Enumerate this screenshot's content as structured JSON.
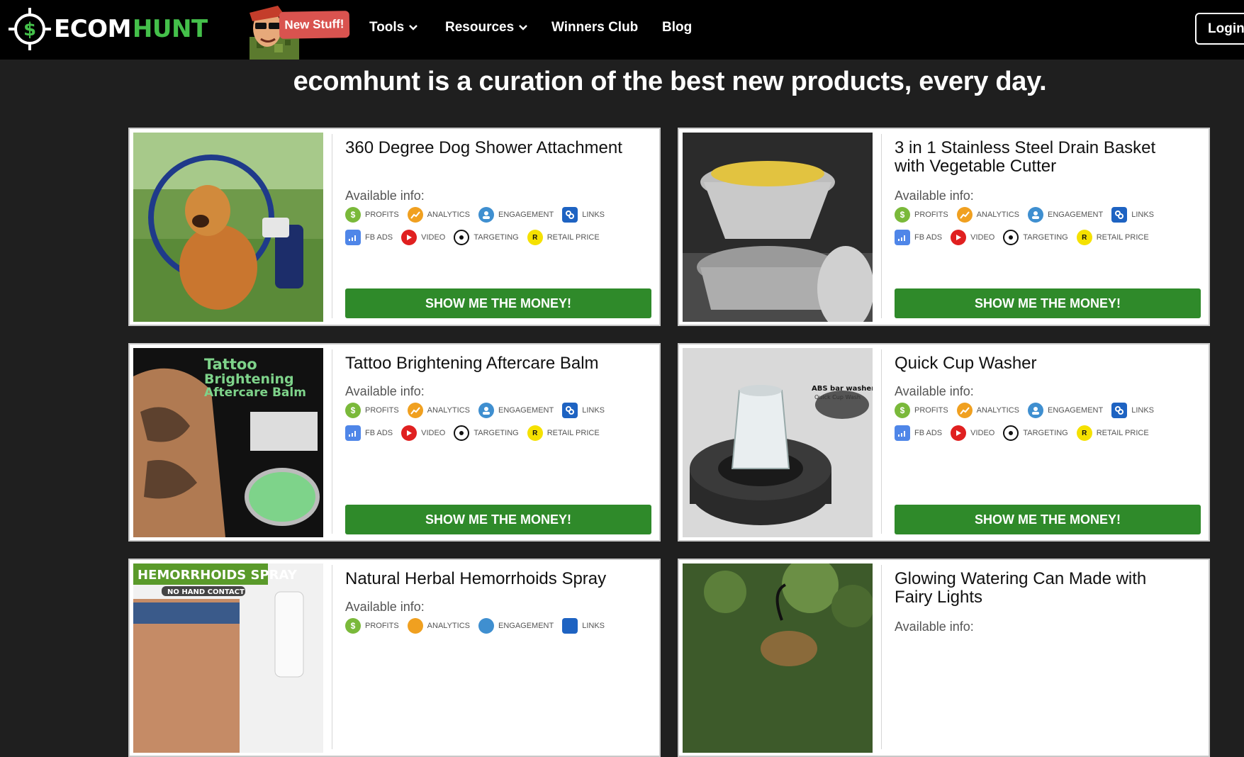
{
  "nav": {
    "logo_part1": "ECOM",
    "logo_part2": "HUNT",
    "badge": "New Stuff!",
    "items": [
      "Tools",
      "Resources",
      "Winners Club",
      "Blog"
    ],
    "login": "Login"
  },
  "headline": "ecomhunt is a curation of the best new products, every day.",
  "info_label": "Available info:",
  "info_items": [
    "PROFITS",
    "ANALYTICS",
    "ENGAGEMENT",
    "LINKS",
    "FB ADS",
    "VIDEO",
    "TARGETING",
    "RETAIL PRICE"
  ],
  "button_label": "SHOW ME THE MONEY!",
  "products": [
    {
      "title": "360 Degree Dog Shower Attachment"
    },
    {
      "title": "3 in 1 Stainless Steel Drain Basket with Vegetable Cutter"
    },
    {
      "title": "Tattoo Brightening Aftercare Balm",
      "image_text": [
        "Tattoo",
        "Brightening",
        "Aftercare Balm"
      ]
    },
    {
      "title": "Quick Cup Washer",
      "image_text": [
        "ABS bar washer",
        "Quick Cup Wash"
      ]
    },
    {
      "title": "Natural Herbal Hemorrhoids Spray",
      "image_text": [
        "HEMORRHOIDS SPRAY",
        "NO HAND CONTACT"
      ]
    },
    {
      "title": "Glowing Watering Can Made with Fairy Lights"
    }
  ],
  "colors": {
    "nav_bg": "#000000",
    "page_bg": "#1f1f1f",
    "brand_green": "#44c04a",
    "button_green": "#2f8a2a",
    "badge_red": "#d9534f"
  }
}
